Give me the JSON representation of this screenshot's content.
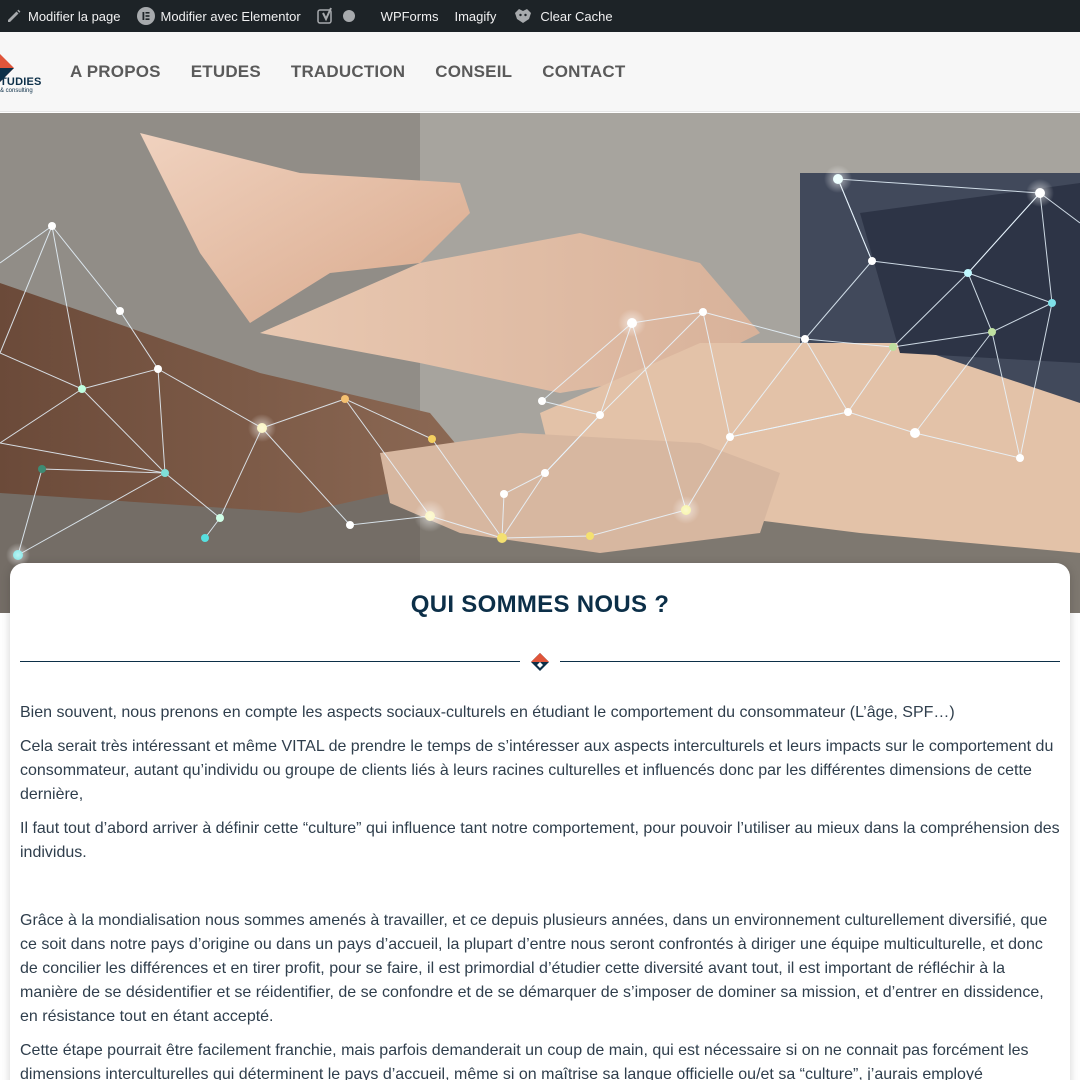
{
  "admin_bar": {
    "edit_page": "Modifier la page",
    "edit_elementor": "Modifier avec Elementor",
    "wpforms": "WPForms",
    "imagify": "Imagify",
    "clear_cache": "Clear Cache"
  },
  "header": {
    "logo_text": "TUDIES",
    "logo_sub": "& consulting",
    "nav": [
      "A PROPOS",
      "ETUDES",
      "TRADUCTION",
      "CONSEIL",
      "CONTACT"
    ]
  },
  "content": {
    "title": "QUI SOMMES NOUS ?",
    "paragraphs": [
      "Bien souvent, nous prenons en compte les aspects sociaux-culturels en étudiant le comportement du consommateur (L’âge, SPF…)",
      "Cela serait très intéressant et même VITAL de prendre le temps de s’intéresser aux aspects interculturels et leurs impacts sur le comportement du consommateur, autant qu’individu ou groupe de clients liés à leurs racines culturelles et influencés donc par les différentes dimensions de cette dernière,",
      "Il faut tout d’abord arriver à définir cette “culture” qui influence tant notre comportement, pour pouvoir l’utiliser au mieux dans la compréhension des individus.",
      "Grâce à la mondialisation nous sommes amenés à travailler, et ce depuis plusieurs années, dans un environnement culturellement diversifié, que ce soit dans notre pays d’origine ou dans un pays d’accueil, la plupart d’entre nous seront confrontés à diriger une équipe multiculturelle, et donc de concilier les différences et en tirer profit, pour se faire, il est primordial d’étudier cette diversité avant tout, il est important de réfléchir à la manière de se désidentifier et se réidentifier, de se confondre et de se démarquer de s’imposer de dominer sa mission, et d’entrer en dissidence, en résistance tout en étant accepté.",
      "Cette étape pourrait être facilement franchie, mais parfois demanderait un coup de main, qui est nécessaire si on ne connait pas forcément les dimensions interculturelles qui déterminent le pays d’accueil, même si on maîtrise sa langue officielle ou/et sa “culture”, j’aurais employé"
    ]
  },
  "colors": {
    "admin_bar_bg": "#1d2327",
    "brand_navy": "#0c2f48",
    "brand_orange": "#e0553a",
    "nav_text": "#5a5a5a"
  }
}
